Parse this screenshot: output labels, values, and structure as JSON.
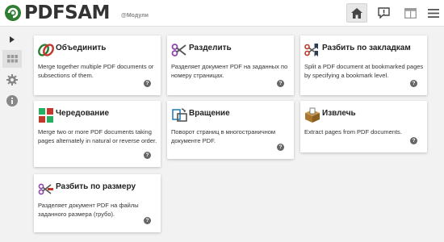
{
  "app": {
    "logo_text": "PDFSAM",
    "edition": "@Модули",
    "brand_color": "#2e7d32"
  },
  "toolbar": {
    "home_icon": "home-icon",
    "news_icon": "news-alert-icon",
    "dashboard_icon": "dashboard-icon",
    "menu_icon": "hamburger-menu-icon"
  },
  "sidebar": {
    "items": [
      {
        "icon": "expand-arrow-icon"
      },
      {
        "icon": "grid-icon"
      },
      {
        "icon": "gear-icon"
      },
      {
        "icon": "info-icon"
      }
    ]
  },
  "modules": [
    {
      "title": "Объединить",
      "description": "Merge together multiple PDF documents or subsections of them.",
      "icon": "merge-icon"
    },
    {
      "title": "Разделить",
      "description": "Разделяет документ PDF на заданных по номеру страницах.",
      "icon": "scissors-icon"
    },
    {
      "title": "Разбить по закладкам",
      "description": "Split a PDF document at bookmarked pages by specifying a bookmark level.",
      "icon": "split-bookmarks-icon"
    },
    {
      "title": "Чередование",
      "description": "Merge two or more PDF documents taking pages alternately in natural or reverse order.",
      "icon": "alternate-mix-icon"
    },
    {
      "title": "Вращение",
      "description": "Поворот страниц в многостраничном документе PDF.",
      "icon": "rotate-icon"
    },
    {
      "title": "Извлечь",
      "description": "Extract pages from PDF documents.",
      "icon": "extract-icon"
    },
    {
      "title": "Разбить по размеру",
      "description": "Разделяет документ PDF на файлы заданного размера (грубо).",
      "icon": "split-by-size-icon"
    }
  ],
  "help_glyph": "?"
}
